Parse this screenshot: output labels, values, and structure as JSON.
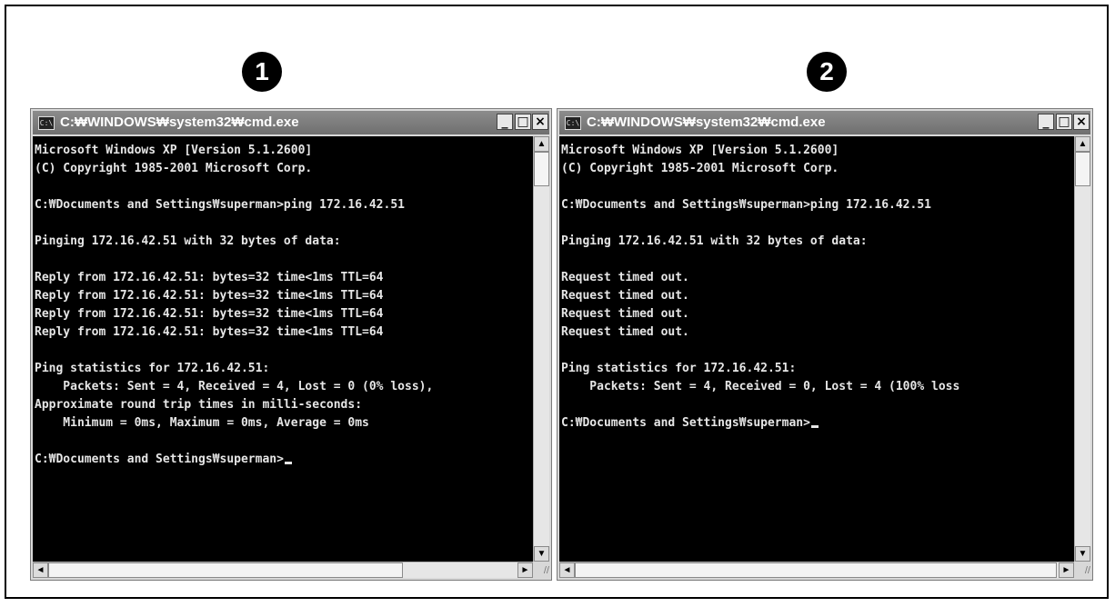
{
  "markers": [
    "1",
    "2"
  ],
  "windows": [
    {
      "title": "C:₩WINDOWS₩system32₩cmd.exe",
      "icon": "C:\\",
      "controls": [
        "_",
        "□",
        "×"
      ],
      "lines": [
        "Microsoft Windows XP [Version 5.1.2600]",
        "(C) Copyright 1985-2001 Microsoft Corp.",
        "",
        "C:₩Documents and Settings₩superman>ping 172.16.42.51",
        "",
        "Pinging 172.16.42.51 with 32 bytes of data:",
        "",
        "Reply from 172.16.42.51: bytes=32 time<1ms TTL=64",
        "Reply from 172.16.42.51: bytes=32 time<1ms TTL=64",
        "Reply from 172.16.42.51: bytes=32 time<1ms TTL=64",
        "Reply from 172.16.42.51: bytes=32 time<1ms TTL=64",
        "",
        "Ping statistics for 172.16.42.51:",
        "    Packets: Sent = 4, Received = 4, Lost = 0 (0% loss),",
        "Approximate round trip times in milli-seconds:",
        "    Minimum = 0ms, Maximum = 0ms, Average = 0ms",
        "",
        "C:₩Documents and Settings₩superman>"
      ]
    },
    {
      "title": "C:₩WINDOWS₩system32₩cmd.exe",
      "icon": "C:\\",
      "controls": [
        "_",
        "□",
        "×"
      ],
      "lines": [
        "Microsoft Windows XP [Version 5.1.2600]",
        "(C) Copyright 1985-2001 Microsoft Corp.",
        "",
        "C:₩Documents and Settings₩superman>ping 172.16.42.51",
        "",
        "Pinging 172.16.42.51 with 32 bytes of data:",
        "",
        "Request timed out.",
        "Request timed out.",
        "Request timed out.",
        "Request timed out.",
        "",
        "Ping statistics for 172.16.42.51:",
        "    Packets: Sent = 4, Received = 0, Lost = 4 (100% loss",
        "",
        "C:₩Documents and Settings₩superman>"
      ]
    }
  ],
  "scroll_glyphs": {
    "up": "▲",
    "down": "▼",
    "left": "◄",
    "right": "►",
    "grip": "//"
  }
}
